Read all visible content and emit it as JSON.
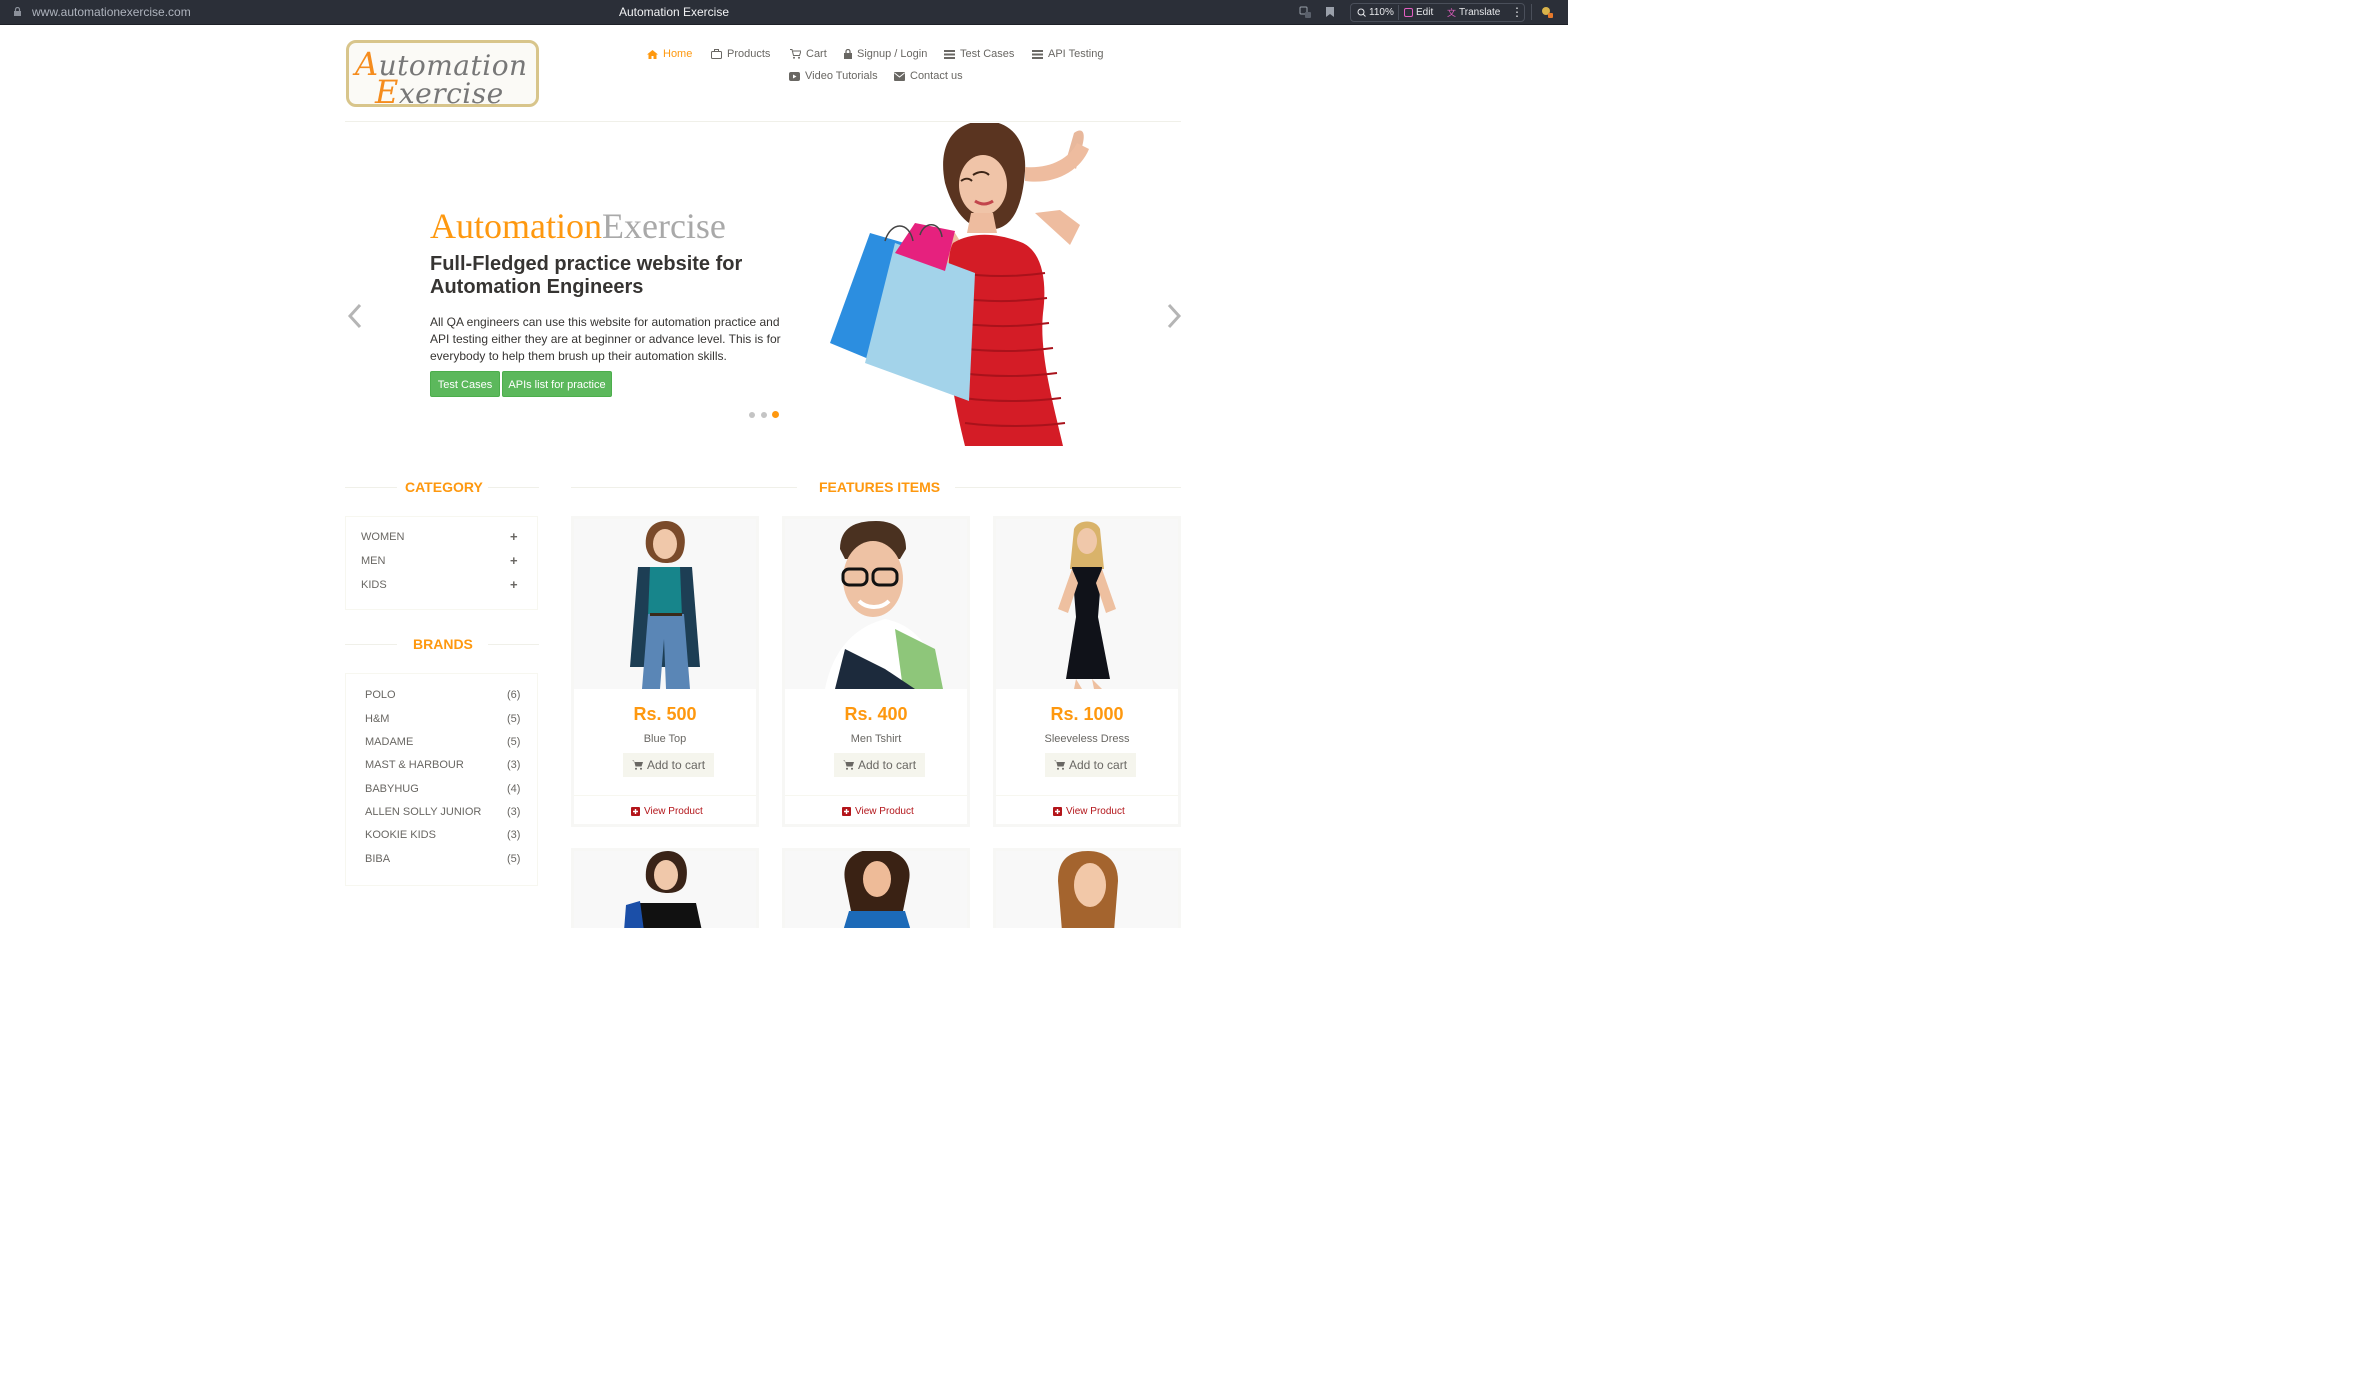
{
  "browser": {
    "url": "www.automationexercise.com",
    "title": "Automation Exercise",
    "zoom": "110%",
    "edit_label": "Edit",
    "translate_label": "Translate"
  },
  "nav": {
    "home": "Home",
    "products": "Products",
    "cart": "Cart",
    "signup": "Signup / Login",
    "test_cases": "Test Cases",
    "api_testing": "API Testing",
    "video": "Video Tutorials",
    "contact": "Contact us"
  },
  "slider": {
    "title_a": "Automation",
    "title_b": "Exercise",
    "subtitle": "Full-Fledged practice website for Automation Engineers",
    "description": "All QA engineers can use this website for automation practice and API testing either they are at beginner or advance level. This is for everybody to help them brush up their automation skills.",
    "btn_test_cases": "Test Cases",
    "btn_apis": "APIs list for practice",
    "active_slide": 3
  },
  "sidebar": {
    "category_title": "CATEGORY",
    "categories": [
      "WOMEN",
      "MEN",
      "KIDS"
    ],
    "brands_title": "BRANDS",
    "brands": [
      {
        "name": "POLO",
        "count": "(6)"
      },
      {
        "name": "H&M",
        "count": "(5)"
      },
      {
        "name": "MADAME",
        "count": "(5)"
      },
      {
        "name": "MAST & HARBOUR",
        "count": "(3)"
      },
      {
        "name": "BABYHUG",
        "count": "(4)"
      },
      {
        "name": "ALLEN SOLLY JUNIOR",
        "count": "(3)"
      },
      {
        "name": "KOOKIE KIDS",
        "count": "(3)"
      },
      {
        "name": "BIBA",
        "count": "(5)"
      }
    ]
  },
  "features": {
    "title": "FEATURES ITEMS",
    "add_label": "Add to cart",
    "view_label": "View Product",
    "items": [
      {
        "price": "Rs. 500",
        "name": "Blue Top"
      },
      {
        "price": "Rs. 400",
        "name": "Men Tshirt"
      },
      {
        "price": "Rs. 1000",
        "name": "Sleeveless Dress"
      }
    ]
  },
  "colors": {
    "accent": "#fe980f",
    "green": "#5cb85c",
    "view": "#b3151a"
  }
}
